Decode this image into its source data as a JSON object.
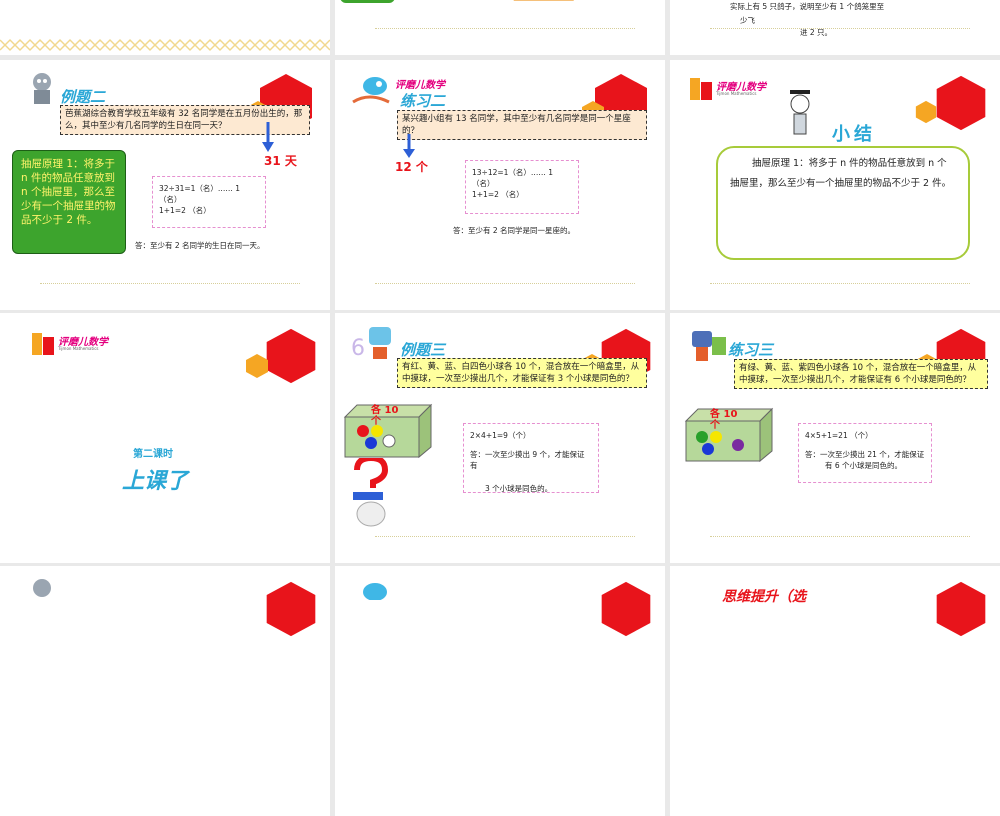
{
  "colors": {
    "red": "#e8141b",
    "orange": "#f5a623",
    "green": "#3da42d",
    "pink": "#e68fd0",
    "blue": "#2aa7d6"
  },
  "logo": {
    "brand": "评磨儿数学",
    "sub": "Tijmon Mathematics"
  },
  "top_row": {
    "s3_line1": "实际上有 5 只鸽子，说明至少有 1 个鸽笼里至",
    "s3_line2": "少飞",
    "s3_line3": "进 2 只。"
  },
  "slide4": {
    "title": "例题二",
    "question": "芭蕉湖综合教育学校五年级有 32 名同学是在五月份出生的，那么，其中至少有几名同学的生日在同一天？",
    "annot": "31 天",
    "scroll": "抽屉原理 1：将多于 n 件的物品任意放到 n 个抽屉里，那么至少有一个抽屉里的物品不少于 2 件。",
    "calc1": "32÷31=1（名）…… 1",
    "calc1b": "（名）",
    "calc2": "1+1=2 （名）",
    "answer": "答：至少有 2 名同学的生日在同一天。"
  },
  "slide5": {
    "title": "练习二",
    "question": "某兴趣小组有 13 名同学，其中至少有几名同学是同一个星座的？",
    "annot": "12 个",
    "calc1": "13÷12=1（名）…… 1",
    "calc1b": "（名）",
    "calc2": "1+1=2 （名）",
    "answer": "答：至少有 2 名同学是同一星座的。"
  },
  "slide6": {
    "title": "小结",
    "text": "抽屉原理 1：将多于 n 件的物品任意放到 n 个抽屉里，那么至少有一个抽屉里的物品不少于 2 件。"
  },
  "slide7": {
    "subtitle": "第二课时",
    "title": "上课了"
  },
  "slide8": {
    "title": "例题三",
    "question": "有红、黄、蓝、白四色小球各 10 个，混合放在一个暗盒里，从中摸球，一次至少摸出几个，才能保证有 3 个小球是同色的？",
    "box_label": "各 10 个",
    "calc": "2×4+1=9（个）",
    "answer1": "答：一次至少摸出 9 个，才能保证有",
    "answer2": "3 个小球是同色的。"
  },
  "slide9": {
    "title": "练习三",
    "question": "有绿、黄、蓝、紫四色小球各 10 个，混合放在一个暗盒里，从中摸球，一次至少摸出几个，才能保证有 6 个小球是同色的？",
    "box_label": "各 10 个",
    "calc": "4×5+1=21 （个）",
    "answer1": "答：一次至少摸出 21 个，才能保证",
    "answer2": "有 6 个小球是同色的。"
  },
  "bottom_row": {
    "s12_title": "思维提升（选"
  }
}
